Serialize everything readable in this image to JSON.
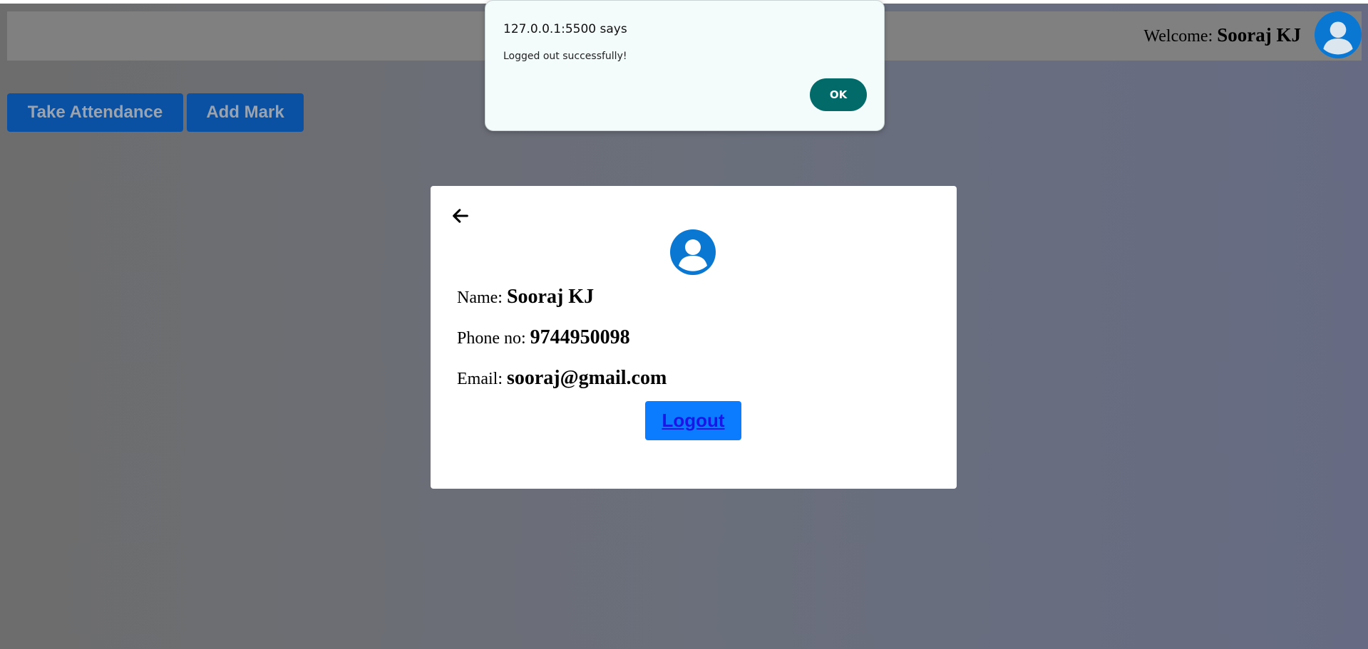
{
  "header": {
    "welcome_label": "Welcome:",
    "user_name": "Sooraj KJ",
    "avatar_icon": "user-circle-icon"
  },
  "nav": {
    "take_attendance_label": "Take Attendance",
    "add_mark_label": "Add Mark"
  },
  "profile": {
    "back_icon": "arrow-left-icon",
    "avatar_icon": "user-circle-icon",
    "name_label": "Name:",
    "name_value": "Sooraj KJ",
    "phone_label": "Phone no:",
    "phone_value": "9744950098",
    "email_label": "Email:",
    "email_value": "sooraj@gmail.com",
    "logout_label": "Logout"
  },
  "dialog": {
    "title": "127.0.0.1:5500 says",
    "message": "Logged out successfully!",
    "ok_label": "OK"
  },
  "colors": {
    "nav_button_bg": "#0a51a3",
    "logout_bg": "#0b7cff",
    "avatar_blue": "#0a78d2",
    "ok_button_bg": "#036a6a"
  }
}
